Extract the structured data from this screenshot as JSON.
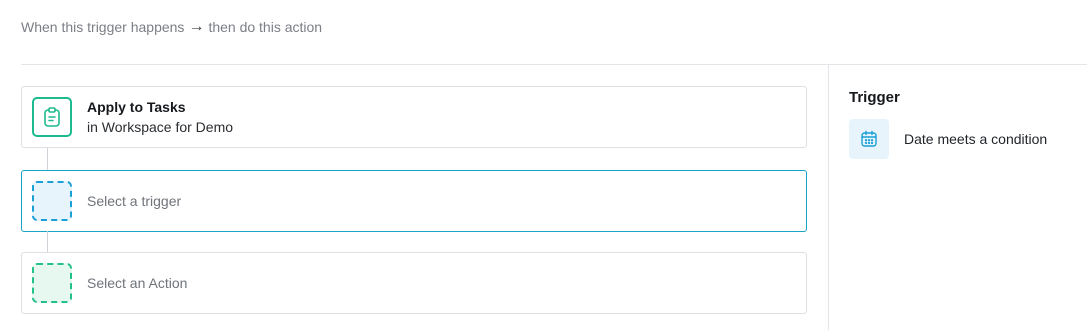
{
  "header": {
    "trigger_text": "When this trigger happens",
    "arrow": "→",
    "action_text": "then do this action"
  },
  "flow": {
    "apply_card": {
      "title": "Apply to Tasks",
      "subtitle": "in Workspace for Demo",
      "icon": "clipboard-icon",
      "accent": "#1dba8f"
    },
    "trigger_card": {
      "placeholder": "Select a trigger",
      "accent": "#19a3c6"
    },
    "action_card": {
      "placeholder": "Select an Action",
      "accent": "#21c08d"
    }
  },
  "panel": {
    "title": "Trigger",
    "options": [
      {
        "label": "Date meets a condition",
        "icon": "calendar-icon",
        "accent": "#1a9fd6"
      }
    ]
  }
}
